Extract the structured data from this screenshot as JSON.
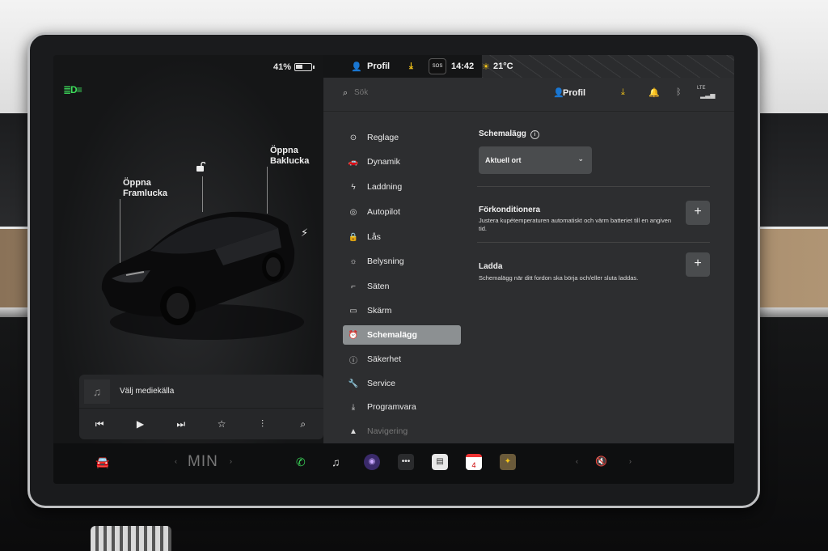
{
  "status": {
    "battery_pct": "41%",
    "profile": "Profil",
    "sos": "SOS",
    "time": "14:42",
    "temperature": "21°C"
  },
  "car": {
    "front_trunk_label_1": "Öppna",
    "front_trunk_label_2": "Framlucka",
    "rear_trunk_label_1": "Öppna",
    "rear_trunk_label_2": "Baklucka"
  },
  "media": {
    "source_label": "Välj mediekälla",
    "controls": [
      "previous-icon",
      "play-icon",
      "next-icon",
      "favorite-icon",
      "equalizer-icon",
      "search-icon"
    ]
  },
  "header": {
    "search_placeholder": "Sök",
    "profile": "Profil",
    "lte": "LTE"
  },
  "nav": {
    "items": [
      {
        "label": "Reglage",
        "icon": "toggle-icon"
      },
      {
        "label": "Dynamik",
        "icon": "car-icon"
      },
      {
        "label": "Laddning",
        "icon": "bolt-icon"
      },
      {
        "label": "Autopilot",
        "icon": "steering-wheel-icon"
      },
      {
        "label": "Lås",
        "icon": "lock-icon"
      },
      {
        "label": "Belysning",
        "icon": "sun-icon"
      },
      {
        "label": "Säten",
        "icon": "seat-icon"
      },
      {
        "label": "Skärm",
        "icon": "display-icon"
      },
      {
        "label": "Schemalägg",
        "icon": "alarm-icon",
        "active": true
      },
      {
        "label": "Säkerhet",
        "icon": "alert-icon"
      },
      {
        "label": "Service",
        "icon": "wrench-icon"
      },
      {
        "label": "Programvara",
        "icon": "download-icon"
      },
      {
        "label": "Navigering",
        "icon": "navigation-icon"
      }
    ]
  },
  "content": {
    "title": "Schemalägg",
    "dropdown_value": "Aktuell ort",
    "precondition_title": "Förkonditionera",
    "precondition_desc": "Justera kupétemperaturen automatiskt och värm batteriet till en angiven tid.",
    "charge_title": "Ladda",
    "charge_desc": "Schemalägg när ditt fordon ska börja och/eller sluta laddas.",
    "plus": "+"
  },
  "taskbar": {
    "climate_label": "MIN",
    "calendar_day": "4"
  },
  "colors": {
    "accent_green": "#3ddc5b",
    "download_yellow": "#f5c518",
    "active_nav": "#8c9092"
  }
}
